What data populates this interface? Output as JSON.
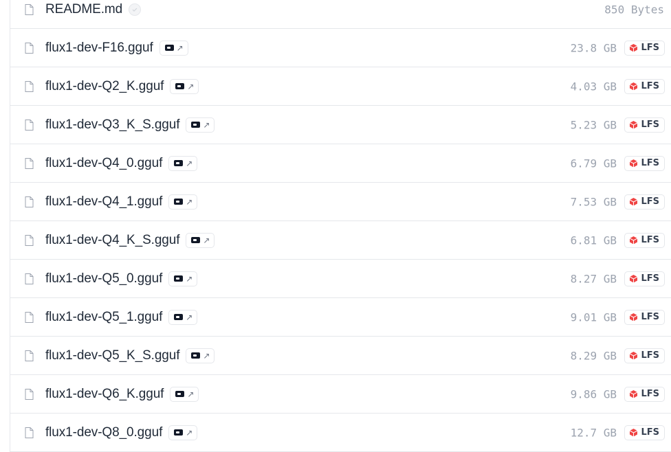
{
  "files": [
    {
      "name": "README.md",
      "size": "850 Bytes",
      "verified": true,
      "xet": false,
      "lfs": false
    },
    {
      "name": "flux1-dev-F16.gguf",
      "size": "23.8 GB",
      "xet": true,
      "lfs": true
    },
    {
      "name": "flux1-dev-Q2_K.gguf",
      "size": "4.03 GB",
      "xet": true,
      "lfs": true
    },
    {
      "name": "flux1-dev-Q3_K_S.gguf",
      "size": "5.23 GB",
      "xet": true,
      "lfs": true
    },
    {
      "name": "flux1-dev-Q4_0.gguf",
      "size": "6.79 GB",
      "xet": true,
      "lfs": true
    },
    {
      "name": "flux1-dev-Q4_1.gguf",
      "size": "7.53 GB",
      "xet": true,
      "lfs": true
    },
    {
      "name": "flux1-dev-Q4_K_S.gguf",
      "size": "6.81 GB",
      "xet": true,
      "lfs": true
    },
    {
      "name": "flux1-dev-Q5_0.gguf",
      "size": "8.27 GB",
      "xet": true,
      "lfs": true
    },
    {
      "name": "flux1-dev-Q5_1.gguf",
      "size": "9.01 GB",
      "xet": true,
      "lfs": true
    },
    {
      "name": "flux1-dev-Q5_K_S.gguf",
      "size": "8.29 GB",
      "xet": true,
      "lfs": true
    },
    {
      "name": "flux1-dev-Q6_K.gguf",
      "size": "9.86 GB",
      "xet": true,
      "lfs": true
    },
    {
      "name": "flux1-dev-Q8_0.gguf",
      "size": "12.7 GB",
      "xet": true,
      "lfs": true
    }
  ],
  "labels": {
    "lfs": "LFS"
  },
  "icons": {
    "file": "file-icon",
    "verified": "verified-check-icon",
    "xet": "xet-storage-icon",
    "external": "external-link-icon",
    "lfs": "lfs-cube-icon"
  },
  "colors": {
    "lfs_red": "#ef4444",
    "size_gray": "#9ca3af",
    "border": "#e5e7eb",
    "name": "#1f2937"
  }
}
